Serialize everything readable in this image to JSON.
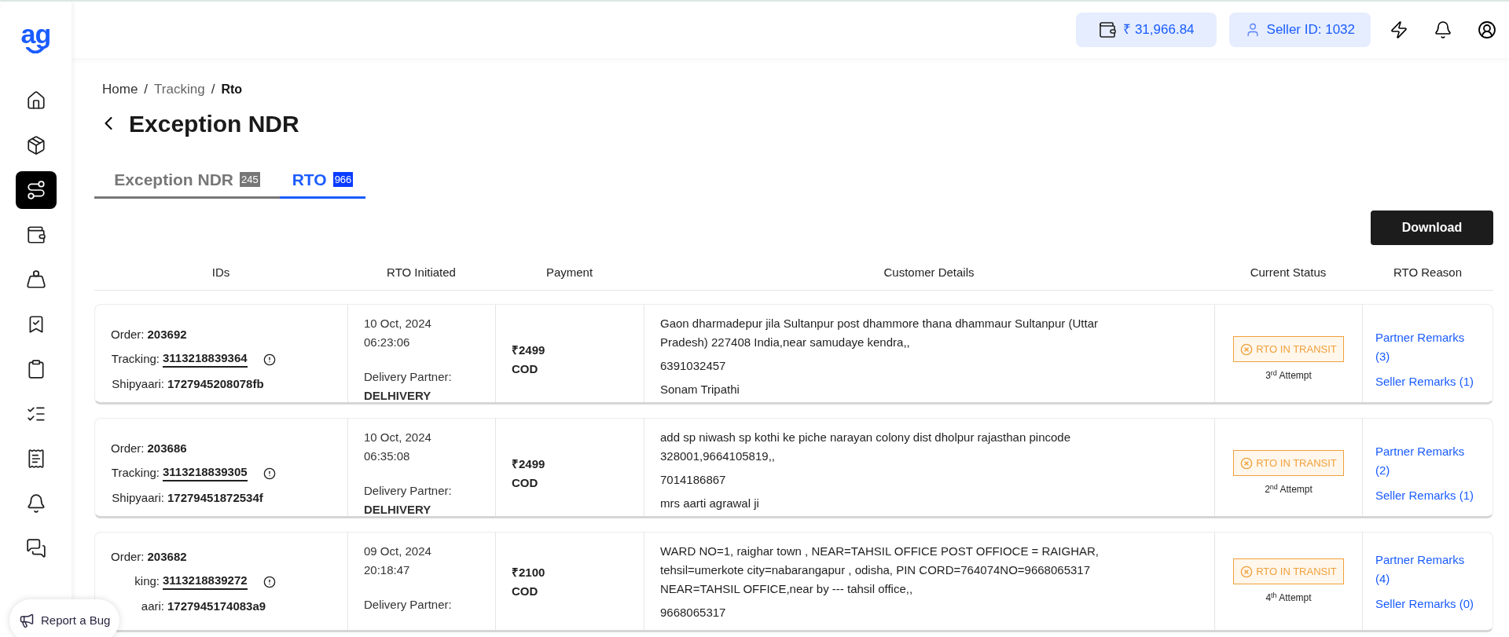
{
  "logo": {
    "text": "ag"
  },
  "sidebar": {
    "items": [
      {
        "selected": false
      },
      {
        "selected": false
      },
      {
        "selected": true
      },
      {
        "selected": false
      },
      {
        "selected": false
      },
      {
        "selected": false
      },
      {
        "selected": false
      },
      {
        "selected": false
      },
      {
        "selected": false
      },
      {
        "selected": false
      },
      {
        "selected": false
      }
    ]
  },
  "header": {
    "wallet_balance": "₹ 31,966.84",
    "seller_id": "Seller ID: 1032"
  },
  "breadcrumb": [
    {
      "label": "Home",
      "current": false
    },
    {
      "separator": "/",
      "label": "Tracking",
      "current": false
    },
    {
      "separator": "/",
      "label": "Rto",
      "current": true
    }
  ],
  "title": "Exception NDR",
  "tabs": [
    {
      "label": "Exception NDR",
      "count": "245",
      "selected": false
    },
    {
      "label": "RTO",
      "count": "966",
      "selected": true
    }
  ],
  "download_button": "Download",
  "table": {
    "columns": [
      "IDs",
      "RTO Initiated",
      "Payment",
      "Customer Details",
      "Current Status",
      "RTO Reason"
    ],
    "rows": [
      {
        "order_label": "Order:",
        "order": "203692",
        "tracking_label": "Tracking:",
        "tracking": "3113218839364",
        "shipyaari_label": "Shipyaari:",
        "shipyaari": "1727945208078fb",
        "date": "10 Oct, 2024",
        "time": "06:23:06",
        "partner_label": "Delivery Partner:",
        "partner": "DELHIVERY",
        "amount": "₹2499",
        "payment_mode": "COD",
        "address": "Gaon dharmadepur jila Sultanpur post dhammore thana dhammaur Sultanpur (Uttar Pradesh) 227408 India,near samudaye kendra,,",
        "phone": "6391032457",
        "name": "Sonam Tripathi",
        "status": "RTO IN TRANSIT",
        "attempt": "3$^{rd}$ Attempt",
        "partner_remarks": "Partner Remarks (3)",
        "seller_remarks": "Seller Remarks (1)"
      },
      {
        "order_label": "Order:",
        "order": "203686",
        "tracking_label": "Tracking:",
        "tracking": "3113218839305",
        "shipyaari_label": "Shipyaari:",
        "shipyaari": "17279451872534f",
        "date": "10 Oct, 2024",
        "time": "06:35:08",
        "partner_label": "Delivery Partner:",
        "partner": "DELHIVERY",
        "amount": "₹2499",
        "payment_mode": "COD",
        "address": "add sp niwash sp kothi ke piche narayan colony dist dholpur rajasthan pincode 328001,9664105819,,",
        "phone": "7014186867",
        "name": "mrs aarti agrawal ji",
        "status": "RTO IN TRANSIT",
        "attempt": "2$^{nd}$ Attempt",
        "partner_remarks": "Partner Remarks (2)",
        "seller_remarks": "Seller Remarks (1)"
      },
      {
        "order_label": "Order:",
        "order": "203682",
        "tracking_label": "king:",
        "tracking": "3113218839272",
        "shipyaari_label": "aari:",
        "shipyaari": "1727945174083a9",
        "date": "09 Oct, 2024",
        "time": "20:18:47",
        "partner_label": "Delivery Partner:",
        "amount": "₹2100",
        "payment_mode": "COD",
        "address": "WARD NO=1, raighar town , NEAR=TAHSIL OFFICE POST OFFIOCE = RAIGHAR, tehsil=umerkote city=nabarangapur , odisha, PIN CORD=764074NO=9668065317 NEAR=TAHSIL OFFICE,near by --- tahsil office,,",
        "phone": "9668065317",
        "status": "RTO IN TRANSIT",
        "attempt": "4$^{th}$ Attempt",
        "partner_remarks": "Partner Remarks (4)",
        "seller_remarks": "Seller Remarks (0)"
      }
    ]
  },
  "report_bug_button": "Report a Bug"
}
